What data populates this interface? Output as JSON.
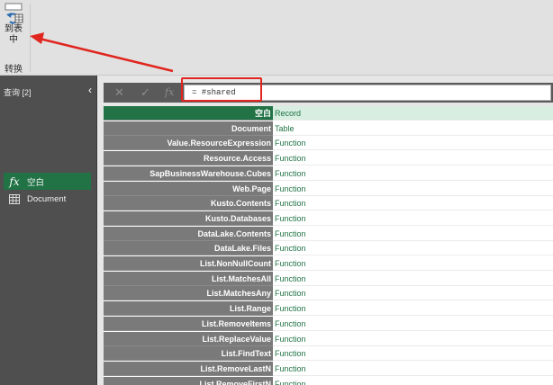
{
  "ribbon": {
    "to_table_line1": "到表",
    "to_table_line2": "中",
    "group_label": "转换"
  },
  "query_pane": {
    "header": "查询",
    "count": "[2]",
    "items": [
      {
        "label": "空白",
        "icon": "fx-icon"
      },
      {
        "label": "Document",
        "icon": "table-icon"
      }
    ]
  },
  "formula_bar": {
    "cancel": "✕",
    "confirm": "✓",
    "fx": "fx",
    "formula": "= #shared"
  },
  "grid": {
    "rows": [
      {
        "name": "空白",
        "value": "Record"
      },
      {
        "name": "Document",
        "value": "Table"
      },
      {
        "name": "Value.ResourceExpression",
        "value": "Function"
      },
      {
        "name": "Resource.Access",
        "value": "Function"
      },
      {
        "name": "SapBusinessWarehouse.Cubes",
        "value": "Function"
      },
      {
        "name": "Web.Page",
        "value": "Function"
      },
      {
        "name": "Kusto.Contents",
        "value": "Function"
      },
      {
        "name": "Kusto.Databases",
        "value": "Function"
      },
      {
        "name": "DataLake.Contents",
        "value": "Function"
      },
      {
        "name": "DataLake.Files",
        "value": "Function"
      },
      {
        "name": "List.NonNullCount",
        "value": "Function"
      },
      {
        "name": "List.MatchesAll",
        "value": "Function"
      },
      {
        "name": "List.MatchesAny",
        "value": "Function"
      },
      {
        "name": "List.Range",
        "value": "Function"
      },
      {
        "name": "List.RemoveItems",
        "value": "Function"
      },
      {
        "name": "List.ReplaceValue",
        "value": "Function"
      },
      {
        "name": "List.FindText",
        "value": "Function"
      },
      {
        "name": "List.RemoveLastN",
        "value": "Function"
      },
      {
        "name": "List.RemoveFirstN",
        "value": "Function"
      }
    ]
  },
  "colors": {
    "accent": "#217346",
    "annotation": "#e0261f"
  }
}
